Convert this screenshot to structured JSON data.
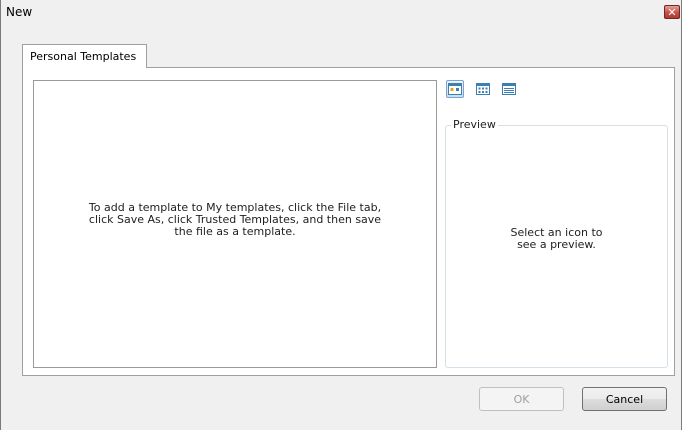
{
  "window": {
    "title": "New",
    "close_glyph": "✕"
  },
  "tabs": [
    {
      "label": "Personal Templates",
      "selected": true
    }
  ],
  "templates": {
    "empty_message": "To add a template to My templates, click the File tab, click Save As, click Trusted Templates, and then save the file as a template."
  },
  "view_buttons": [
    {
      "name": "large-icons-view-icon",
      "selected": true
    },
    {
      "name": "list-view-icon",
      "selected": false
    },
    {
      "name": "details-view-icon",
      "selected": false
    }
  ],
  "preview": {
    "legend": "Preview",
    "message": "Select an icon to see a preview."
  },
  "buttons": {
    "ok_label": "OK",
    "ok_enabled": false,
    "cancel_label": "Cancel"
  },
  "colors": {
    "accent": "#3c7fb1",
    "close_red": "#c75050"
  }
}
